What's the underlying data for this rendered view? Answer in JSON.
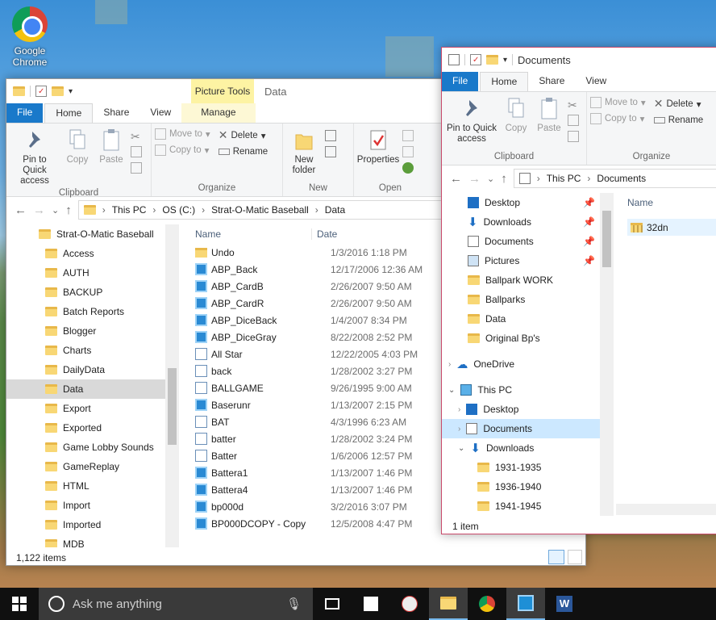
{
  "desktop": {
    "icon_label": "Google Chrome"
  },
  "left_window": {
    "context_tab": "Picture Tools",
    "title": "Data",
    "tabs": [
      "File",
      "Home",
      "Share",
      "View",
      "Manage"
    ],
    "ribbon": {
      "pin": "Pin to Quick access",
      "copy": "Copy",
      "paste": "Paste",
      "clipboard": "Clipboard",
      "move_to": "Move to",
      "copy_to": "Copy to",
      "delete": "Delete",
      "rename": "Rename",
      "organize": "Organize",
      "new_folder": "New folder",
      "new": "New",
      "properties": "Properties",
      "open": "Open"
    },
    "breadcrumb": [
      "This PC",
      "OS (C:)",
      "Strat-O-Matic Baseball",
      "Data"
    ],
    "tree": [
      "Strat-O-Matic Baseball",
      "Access",
      "AUTH",
      "BACKUP",
      "Batch Reports",
      "Blogger",
      "Charts",
      "DailyData",
      "Data",
      "Export",
      "Exported",
      "Game Lobby Sounds",
      "GameReplay",
      "HTML",
      "Import",
      "Imported",
      "MDB"
    ],
    "columns": {
      "name": "Name",
      "date": "Date"
    },
    "files": [
      {
        "name": "Undo",
        "date": "1/3/2016 1:18 PM",
        "type": "fold"
      },
      {
        "name": "ABP_Back",
        "date": "12/17/2006 12:36 AM",
        "type": "app"
      },
      {
        "name": "ABP_CardB",
        "date": "2/26/2007 9:50 AM",
        "type": "app"
      },
      {
        "name": "ABP_CardR",
        "date": "2/26/2007 9:50 AM",
        "type": "app"
      },
      {
        "name": "ABP_DiceBack",
        "date": "1/4/2007 8:34 PM",
        "type": "app"
      },
      {
        "name": "ABP_DiceGray",
        "date": "8/22/2008 2:52 PM",
        "type": "app"
      },
      {
        "name": "All Star",
        "date": "12/22/2005 4:03 PM",
        "type": "doc"
      },
      {
        "name": "back",
        "date": "1/28/2002 3:27 PM",
        "type": "doc"
      },
      {
        "name": "BALLGAME",
        "date": "9/26/1995 9:00 AM",
        "type": "doc"
      },
      {
        "name": "Baserunr",
        "date": "1/13/2007 2:15 PM",
        "type": "app"
      },
      {
        "name": "BAT",
        "date": "4/3/1996 6:23 AM",
        "type": "doc"
      },
      {
        "name": "batter",
        "date": "1/28/2002 3:24 PM",
        "type": "doc"
      },
      {
        "name": "Batter",
        "date": "1/6/2006 12:57 PM",
        "type": "doc"
      },
      {
        "name": "Battera1",
        "date": "1/13/2007 1:46 PM",
        "type": "app"
      },
      {
        "name": "Battera4",
        "date": "1/13/2007 1:46 PM",
        "type": "app"
      },
      {
        "name": "bp000d",
        "date": "3/2/2016 3:07 PM",
        "type": "app"
      },
      {
        "name": "BP000DCOPY - Copy",
        "date": "12/5/2008 4:47 PM",
        "type": "app"
      }
    ],
    "status": "1,122 items"
  },
  "right_window": {
    "title": "Documents",
    "tabs": [
      "File",
      "Home",
      "Share",
      "View"
    ],
    "ribbon": {
      "pin": "Pin to Quick access",
      "copy": "Copy",
      "paste": "Paste",
      "clipboard": "Clipboard",
      "move_to": "Move to",
      "copy_to": "Copy to",
      "delete": "Delete",
      "rename": "Rename",
      "organize": "Organize"
    },
    "breadcrumb": [
      "This PC",
      "Documents"
    ],
    "quick_access": [
      "Desktop",
      "Downloads",
      "Documents",
      "Pictures",
      "Ballpark WORK",
      "Ballparks",
      "Data",
      "Original Bp's"
    ],
    "onedrive": "OneDrive",
    "this_pc": "This PC",
    "pc_items": [
      "Desktop",
      "Documents",
      "Downloads"
    ],
    "download_folders": [
      "1931-1935",
      "1936-1940",
      "1941-1945"
    ],
    "column_name": "Name",
    "file": "32dn",
    "status": "1 item"
  },
  "taskbar": {
    "search_placeholder": "Ask me anything"
  }
}
